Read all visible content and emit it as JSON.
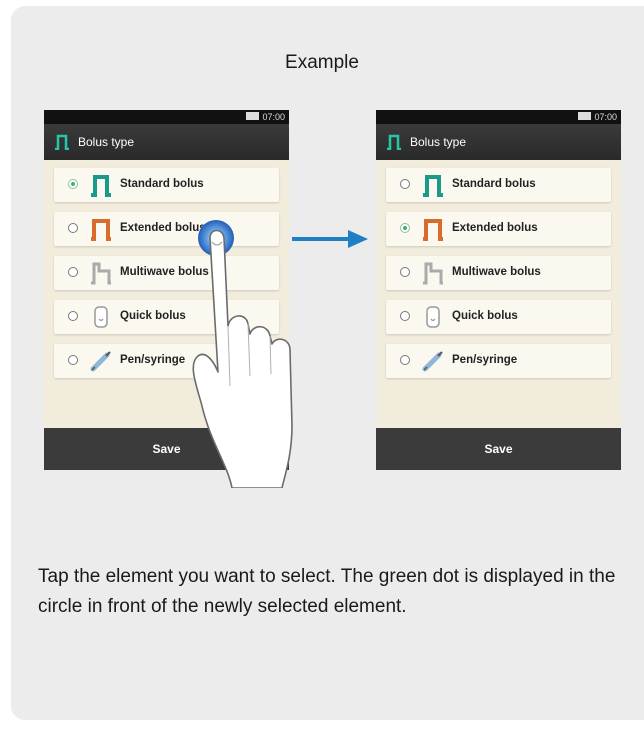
{
  "example_title": "Example",
  "phones": [
    {
      "status_time": "07:00",
      "title": "Bolus type",
      "items": [
        {
          "label": "Standard bolus",
          "selected": true,
          "icon": "standard-bolus-icon"
        },
        {
          "label": "Extended bolus",
          "selected": false,
          "icon": "extended-bolus-icon"
        },
        {
          "label": "Multiwave bolus",
          "selected": false,
          "icon": "multiwave-bolus-icon"
        },
        {
          "label": "Quick bolus",
          "selected": false,
          "icon": "quick-bolus-icon"
        },
        {
          "label": "Pen/syringe",
          "selected": false,
          "icon": "pen-syringe-icon"
        }
      ],
      "save_label": "Save"
    },
    {
      "status_time": "07:00",
      "title": "Bolus type",
      "items": [
        {
          "label": "Standard bolus",
          "selected": false,
          "icon": "standard-bolus-icon"
        },
        {
          "label": "Extended bolus",
          "selected": true,
          "icon": "extended-bolus-icon"
        },
        {
          "label": "Multiwave bolus",
          "selected": false,
          "icon": "multiwave-bolus-icon"
        },
        {
          "label": "Quick bolus",
          "selected": false,
          "icon": "quick-bolus-icon"
        },
        {
          "label": "Pen/syringe",
          "selected": false,
          "icon": "pen-syringe-icon"
        }
      ],
      "save_label": "Save"
    }
  ],
  "instruction": "Tap the element you want to select. The green dot is displayed in the circle in front of the newly selected element.",
  "colors": {
    "standard": "#1a9a8a",
    "extended": "#d96b2b",
    "multiwave": "#aaaaaa",
    "selected_dot": "#3bb36a",
    "arrow": "#1f7fc4"
  }
}
